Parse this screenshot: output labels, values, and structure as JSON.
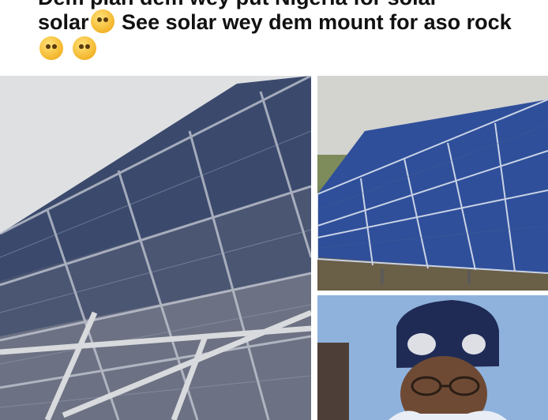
{
  "post": {
    "caption_line0": "Dem plan dem wey put Nigeria for solar",
    "caption_line1_text": "solar",
    "caption_line1_rest": " See solar wey dem mount for aso rock",
    "emojis": [
      "laughing-crying-face-emoji",
      "flushed-face-emoji",
      "loudly-crying-face-emoji"
    ]
  },
  "images": [
    {
      "name": "solar-canopy-photo",
      "subject": "solar panels mounted on overhead steel frame"
    },
    {
      "name": "ground-solar-array-photo",
      "subject": "ground-mounted solar panel array"
    },
    {
      "name": "man-portrait-photo",
      "subject": "man in traditional cap"
    }
  ],
  "colors": {
    "panel_blue": "#2f4f9a",
    "text": "#111111",
    "background": "#ffffff"
  }
}
